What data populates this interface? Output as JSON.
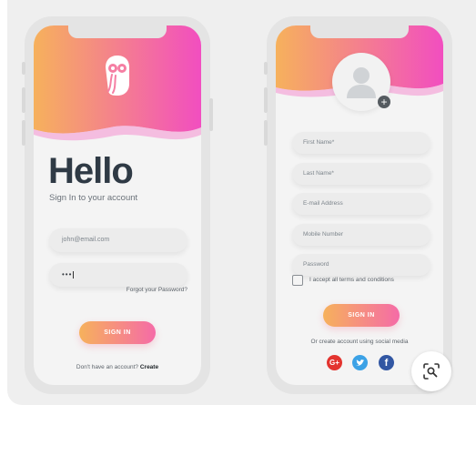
{
  "login_screen": {
    "heading": "Hello",
    "subtitle": "Sign In to your account",
    "email_value": "john@email.com",
    "password_value": "•••",
    "forgot_link": "Forgot your Password?",
    "sign_in_button": "SIGN IN",
    "no_account_text": "Don't have an account?",
    "create_link": "Create"
  },
  "signup_screen": {
    "fields": [
      {
        "placeholder": "First Name*"
      },
      {
        "placeholder": "Last Name*"
      },
      {
        "placeholder": "E-mail Address"
      },
      {
        "placeholder": "Mobile Number"
      },
      {
        "placeholder": "Password"
      }
    ],
    "terms_label": "I accept all terms and conditions",
    "sign_in_button": "SIGN IN",
    "social_note": "Or create account using social media",
    "social": [
      {
        "icon": "google-plus-icon",
        "glyph": "G+"
      },
      {
        "icon": "twitter-icon",
        "glyph": ""
      },
      {
        "icon": "facebook-icon",
        "glyph": "f"
      }
    ],
    "avatar_icon": "user-avatar-icon",
    "add_icon": "plus-icon",
    "add_glyph": "+"
  },
  "colors": {
    "gradient_start": "#f6b15c",
    "gradient_end": "#f24ec0",
    "heading": "#2f3a45",
    "google": "#e3342f",
    "twitter": "#3ca2e6",
    "facebook": "#3257a3"
  },
  "lens_button": {
    "icon": "visual-search-icon"
  }
}
